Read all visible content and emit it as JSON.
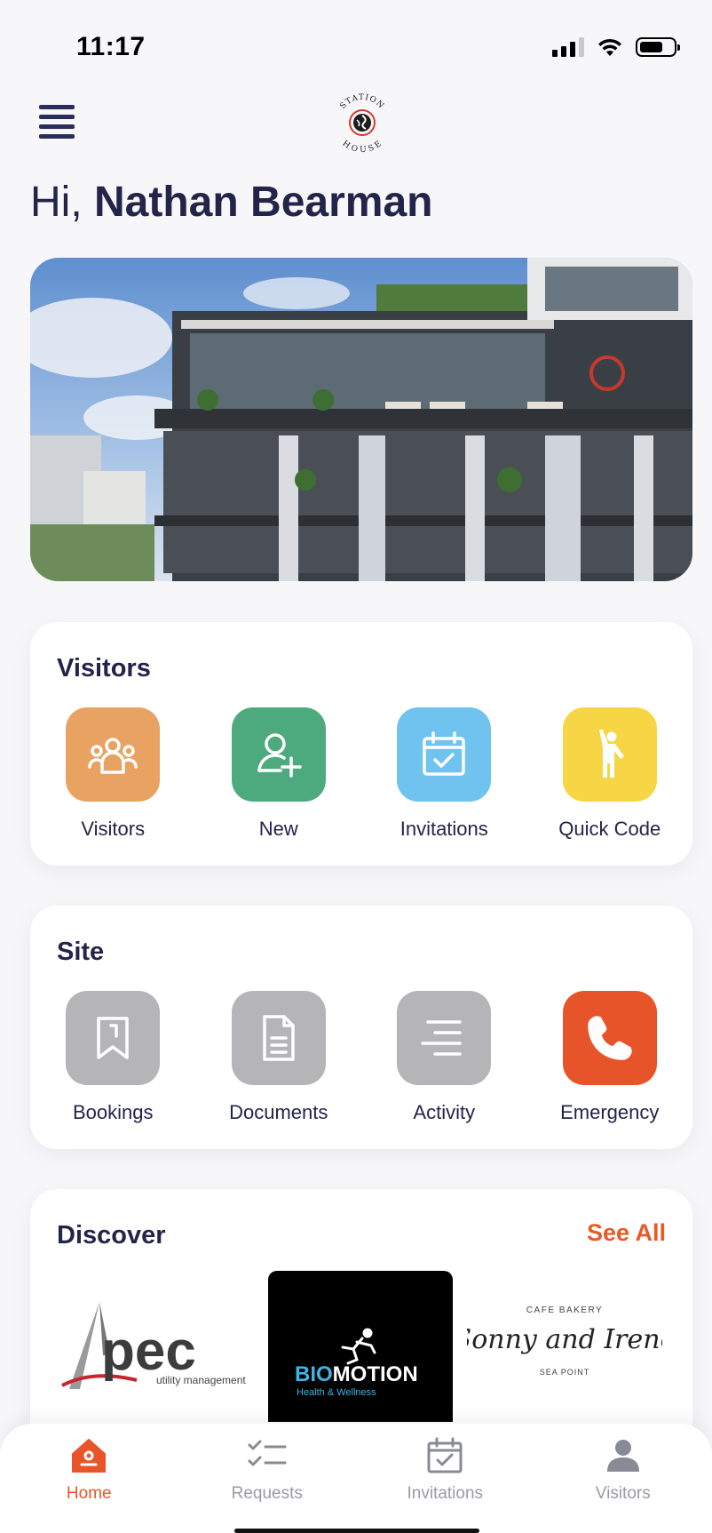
{
  "status_bar": {
    "time": "11:17",
    "battery_level": 0.7
  },
  "header": {
    "greeting_prefix": "Hi,",
    "user_name": "Nathan Bearman",
    "logo_text_top": "STATION",
    "logo_text_bottom": "HOUSE"
  },
  "visitors_card": {
    "title": "Visitors",
    "tiles": [
      {
        "label": "Visitors",
        "icon": "group-icon",
        "color": "#e8a363"
      },
      {
        "label": "New",
        "icon": "add-user-icon",
        "color": "#4daa7e"
      },
      {
        "label": "Invitations",
        "icon": "calendar-check-icon",
        "color": "#6fc3ee"
      },
      {
        "label": "Quick Code",
        "icon": "person-waving-icon",
        "color": "#f6d645"
      }
    ]
  },
  "site_card": {
    "title": "Site",
    "tiles": [
      {
        "label": "Bookings",
        "icon": "bookmark-icon",
        "color": "#b5b5b8"
      },
      {
        "label": "Documents",
        "icon": "document-icon",
        "color": "#b5b5b8"
      },
      {
        "label": "Activity",
        "icon": "list-icon",
        "color": "#b5b5b8"
      },
      {
        "label": "Emergency",
        "icon": "phone-icon",
        "color": "#e8542a"
      }
    ]
  },
  "discover_card": {
    "title": "Discover",
    "see_all": "See All",
    "items": [
      {
        "logo_text": "pec",
        "sub_text": "utility management"
      },
      {
        "logo_text_a": "BIO",
        "logo_text_b": "MOTION",
        "sub_text": "Health & Wellness"
      },
      {
        "top_text": "CAFE BAKERY",
        "logo_text": "Sonny and Irene",
        "sub_text": "SEA POINT"
      }
    ]
  },
  "bottom_nav": {
    "items": [
      {
        "label": "Home",
        "active": true
      },
      {
        "label": "Requests",
        "active": false
      },
      {
        "label": "Invitations",
        "active": false
      },
      {
        "label": "Visitors",
        "active": false
      }
    ]
  },
  "colors": {
    "accent": "#e8552a",
    "text_dark": "#24244a",
    "nav_inactive": "#9a9aa6"
  }
}
